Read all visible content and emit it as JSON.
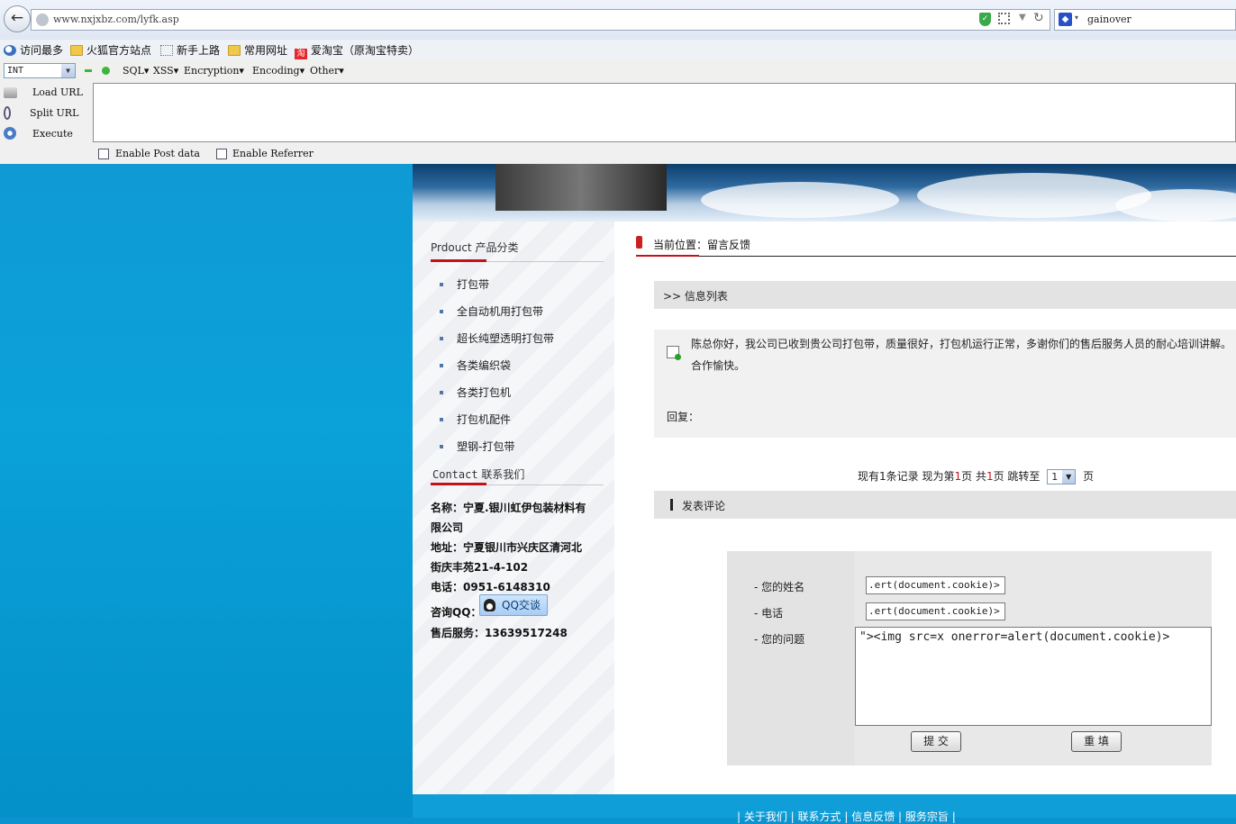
{
  "browser": {
    "url": "www.nxjxbz.com/lyfk.asp",
    "search_engine_icon": "paw-icon",
    "search_value": "gainover"
  },
  "bookmarks": [
    {
      "label": "访问最多",
      "icon": "magnifier-icon"
    },
    {
      "label": "火狐官方站点",
      "icon": "folder-icon"
    },
    {
      "label": "新手上路",
      "icon": "page-icon"
    },
    {
      "label": "常用网址",
      "icon": "folder-icon"
    },
    {
      "label": "爱淘宝（原淘宝特卖）",
      "icon": "taobao-icon",
      "glyph": "淘"
    }
  ],
  "hackbar": {
    "type_select": "INT",
    "menus": [
      "SQL▾",
      "XSS▾",
      "Encryption▾",
      "Encoding▾",
      "Other▾"
    ],
    "load_url": "Load URL",
    "split_url": "Split URL",
    "execute": "Execute",
    "enable_post": "Enable Post data",
    "enable_referrer": "Enable Referrer",
    "textarea_value": ""
  },
  "sidebar": {
    "product_title_en": "Prdouct",
    "product_title_cn": "产品分类",
    "categories": [
      "打包带",
      "全自动机用打包带",
      "超长纯塑透明打包带",
      "各类编织袋",
      "各类打包机",
      "打包机配件",
      "塑钢-打包带"
    ],
    "contact_title_en": "Contact",
    "contact_title_cn": "联系我们",
    "company_line1": "名称：宁夏.银川虹伊包装材料有",
    "company_line2": "限公司",
    "address_line1": "地址：宁夏银川市兴庆区清河北",
    "address_line2": "街庆丰苑21-4-102",
    "phone": "电话：0951-6148310",
    "qq_label": "咨询QQ：",
    "qq_button": "QQ交谈",
    "after_sales": "售后服务：13639517248"
  },
  "content": {
    "breadcrumb": "当前位置：留言反馈",
    "list_title": ">> 信息列表",
    "message": "陈总你好，我公司已收到贵公司打包带，质量很好，打包机运行正常，多谢你们的售后服务人员的耐心培训讲解。合作愉快。",
    "reply_label": "回复：",
    "pager": {
      "prefix": "现有",
      "records": "1",
      "mid1": "条记录  现为第",
      "current": "1",
      "mid2": "页  共",
      "total": "1",
      "mid3": "页  跳转至",
      "select_value": "1",
      "suffix": "页"
    },
    "comment_title": "发表评论",
    "form": {
      "name_label": "- 您的姓名",
      "phone_label": "- 电话",
      "question_label": "- 您的问题",
      "name_value": ".ert(document.cookie)>",
      "phone_value": ".ert(document.cookie)>",
      "question_value": "\"><img src=x onerror=alert(document.cookie)>",
      "submit": "提 交",
      "reset": "重 填"
    }
  },
  "footer": {
    "links": "| 关于我们 | 联系方式 | 信息反馈 | 服务宗旨 |"
  },
  "colors": {
    "accent_red": "#c4121a",
    "page_blue": "#0a93cf"
  }
}
